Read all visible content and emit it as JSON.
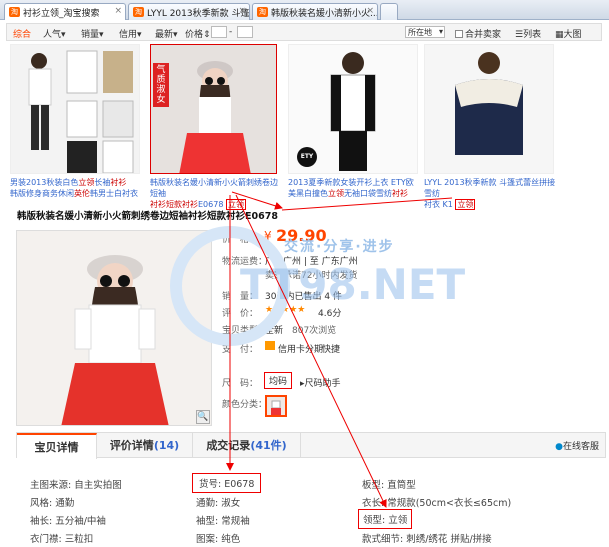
{
  "tabs": [
    {
      "label": "衬衫立领_淘宝搜索",
      "icon": "taobao-icon"
    },
    {
      "label": "LYYL 2013秋季新款 斗篷...",
      "icon": "taobao-icon"
    },
    {
      "label": "韩版秋装名媛小清新小火...",
      "icon": "taobao-icon"
    }
  ],
  "filters": {
    "zonghe": "综合",
    "renqi": "人气",
    "xiaoliang": "销量",
    "xinyong": "信用",
    "zuixin": "最新",
    "jiage": "价格",
    "range_sep": "-",
    "location": "所在地",
    "merge": "合并卖家",
    "list_view": "列表",
    "grid_view": "大图"
  },
  "products": [
    {
      "line1": "男装2013秋装白色",
      "red": "立领",
      "line1b": "长袖",
      "line1c": "衬衫",
      "line2": "韩版修身商务休闲",
      "line2b": "英伦",
      "line2c": "韩男士白衬衣"
    },
    {
      "line1": "韩版秋装名媛小清新小火箭刺绣卷边短袖",
      "line2": "衬衫短款",
      "line2b": "衬衫",
      "code": "E0678",
      "red": "立领",
      "badge": "气质淑女"
    },
    {
      "line1": "2013夏季新款女装开衫上衣 ETY欧美黑白撞色",
      "red": "立领",
      "line2": "无袖口袋雪纺",
      "line2b": "衬衫",
      "brand": "ETY"
    },
    {
      "line1": "LYYL 2013秋季新款 斗篷式蕾丝拼接雪纺",
      "line2": "衬衣 K1",
      "red": "立领"
    }
  ],
  "product": {
    "title": "韩版秋装名媛小清新小火箭刺绣卷边短袖衬衫短款衬衫E0678",
    "price_label": "价　格：",
    "price_yen": "¥",
    "price": "29.90",
    "shipping_label": "物流运费：",
    "shipping_from": "广东广州 | 至 广东广州",
    "shipping_note": "卖家承诺72小时内发货",
    "sales_label": "销　量：",
    "sales_value": "30天内已售出 4 件",
    "rating_label": "评　价：",
    "rating_stars": "★★★★★",
    "rating_value": "4.6分",
    "type_label": "宝贝类型：",
    "type_value": "全新",
    "views_value": "807次浏览",
    "pay_label": "支　付：",
    "pay_value": "信用卡分期",
    "pay_quick": "快捷",
    "size_label": "尺　码：",
    "size_value": "均码",
    "size_help": "尺码助手",
    "color_label": "颜色分类："
  },
  "detail_tabs": [
    {
      "label": "宝贝详情"
    },
    {
      "label": "评价详情",
      "count": "(14)"
    },
    {
      "label": "成交记录",
      "count": "(41件)"
    }
  ],
  "service": "在线客服",
  "attrs": {
    "c1": [
      "主图来源: 自主实拍图",
      "风格: 通勤",
      "袖长: 五分袖/中袖",
      "衣门襟: 三粒扣"
    ],
    "c2": [
      "货号: E0678",
      "通勤: 淑女",
      "袖型: 常规袖",
      "图案: 纯色"
    ],
    "c3": [
      "板型: 直筒型",
      "衣长: 常规款(50cm<衣长≤65cm)",
      "领型: 立领",
      "款式细节: 刺绣/绣花 拼贴/拼接"
    ]
  },
  "watermark": {
    "site": "TT98.NET",
    "tagline": "交流·分享·进步"
  },
  "colors": {
    "accent": "#ff4400",
    "price": "#ff4400",
    "link": "#3366cc",
    "annotation": "#ee0000"
  }
}
